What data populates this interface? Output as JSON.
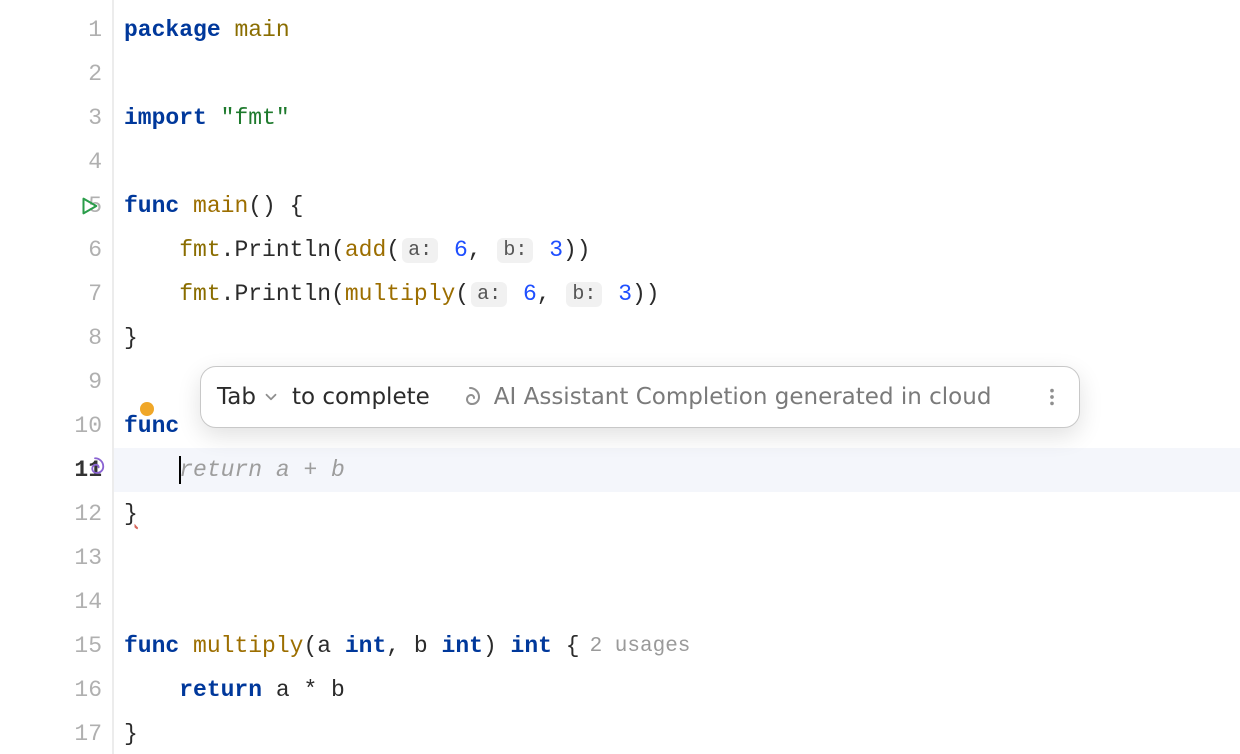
{
  "gutter": {
    "lines": [
      "1",
      "2",
      "3",
      "4",
      "5",
      "6",
      "7",
      "8",
      "9",
      "10",
      "11",
      "12",
      "13",
      "14",
      "15",
      "16",
      "17"
    ],
    "run_line": 5,
    "ai_line": 11,
    "active_line": 11
  },
  "code": {
    "l1_package": "package",
    "l1_main": "main",
    "l3_import": "import",
    "l3_fmt": "\"fmt\"",
    "l5_func": "func",
    "l5_main": "main",
    "l5_parens": "()",
    "l5_brace": " {",
    "l6_indent": "    ",
    "l6_fmt": "fmt",
    "l6_println": ".Println(",
    "l6_add": "add",
    "l6_open": "(",
    "l6_hint_a": "a:",
    "l6_num_a": "6",
    "l6_comma": ", ",
    "l6_hint_b": "b:",
    "l6_num_b": "3",
    "l6_close": "))",
    "l7_indent": "    ",
    "l7_fmt": "fmt",
    "l7_println": ".Println(",
    "l7_mul": "multiply",
    "l7_open": "(",
    "l7_hint_a": "a:",
    "l7_num_a": "6",
    "l7_comma": ", ",
    "l7_hint_b": "b:",
    "l7_num_b": "3",
    "l7_close": "))",
    "l8_brace": "}",
    "l10_func": "func",
    "l11_indent": "    ",
    "l11_suggest": "return a + b",
    "l12_brace": "}",
    "l15_func": "func",
    "l15_mul": "multiply",
    "l15_sig_open": "(",
    "l15_a": "a ",
    "l15_int1": "int",
    "l15_comma": ", ",
    "l15_b": "b ",
    "l15_int2": "int",
    "l15_sig_close": ") ",
    "l15_ret": "int",
    "l15_brace": " {",
    "l15_usages": "2 usages",
    "l16_indent": "    ",
    "l16_return": "return",
    "l16_expr": " a * b",
    "l17_brace": "}"
  },
  "popup": {
    "tab_label": "Tab",
    "complete": "to complete",
    "ai_text": "AI Assistant Completion generated in cloud"
  }
}
